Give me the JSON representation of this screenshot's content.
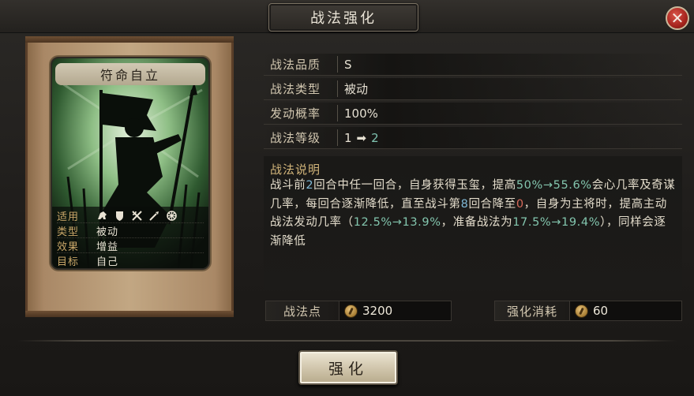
{
  "window": {
    "title": "战法强化",
    "close_icon": "close-icon"
  },
  "card": {
    "name": "符命自立",
    "info": [
      {
        "key": "适用",
        "icons": [
          "cavalry-icon",
          "shield-icon",
          "bow-icon",
          "spear-icon",
          "wheel-icon"
        ]
      },
      {
        "key": "类型",
        "value": "被动"
      },
      {
        "key": "效果",
        "value": "增益"
      },
      {
        "key": "目标",
        "value": "自己"
      }
    ]
  },
  "stats": {
    "quality_label": "战法品质",
    "quality_value": "S",
    "type_label": "战法类型",
    "type_value": "被动",
    "rate_label": "发动概率",
    "rate_value": "100%",
    "level_label": "战法等级",
    "level_from": "1",
    "level_to": "2"
  },
  "description": {
    "title": "战法说明",
    "segments": [
      {
        "text": "战斗前",
        "style": "normal"
      },
      {
        "text": "2",
        "style": "blue"
      },
      {
        "text": "回合中任一回合，自身获得玉玺，提高",
        "style": "normal"
      },
      {
        "text": "50%→55.6%",
        "style": "green"
      },
      {
        "text": "会心几率及奇谋几率，每回合逐渐降低，直至战斗第",
        "style": "normal"
      },
      {
        "text": "8",
        "style": "blue"
      },
      {
        "text": "回合降至",
        "style": "normal"
      },
      {
        "text": "0",
        "style": "red"
      },
      {
        "text": "，自身为主将时，提高主动战法发动几率（",
        "style": "normal"
      },
      {
        "text": "12.5%→13.9%",
        "style": "green"
      },
      {
        "text": "，准备战法为",
        "style": "normal"
      },
      {
        "text": "17.5%→19.4%",
        "style": "green"
      },
      {
        "text": "），同样会逐渐降低",
        "style": "normal"
      }
    ]
  },
  "resources": {
    "points_label": "战法点",
    "points_value": "3200",
    "cost_label": "强化消耗",
    "cost_value": "60",
    "coin_icon": "coin-icon"
  },
  "actions": {
    "upgrade_label": "强化"
  },
  "colors": {
    "highlight_green": "#83c6ae",
    "highlight_blue": "#7fb8d6",
    "highlight_red": "#d86a5a",
    "label_gold": "#c9a769"
  }
}
